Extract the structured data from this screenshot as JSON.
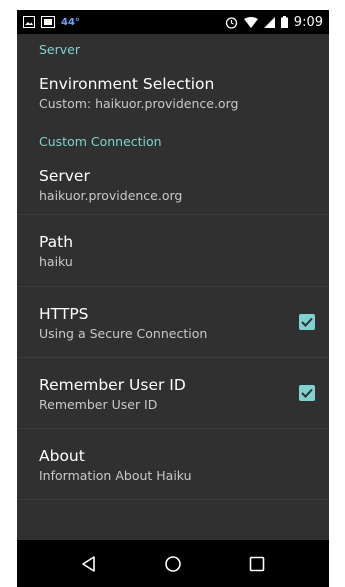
{
  "status_bar": {
    "temperature": "44°",
    "time": "9:09",
    "icons": [
      "image-icon",
      "gallery-icon",
      "alarm-icon",
      "wifi-icon",
      "signal-icon",
      "battery-icon"
    ]
  },
  "sections": [
    {
      "header": "Server",
      "items": [
        {
          "title": "Environment Selection",
          "subtitle": "Custom: haikuor.providence.org"
        }
      ]
    },
    {
      "header": "Custom Connection",
      "items": [
        {
          "title": "Server",
          "subtitle": "haikuor.providence.org"
        },
        {
          "title": "Path",
          "subtitle": "haiku"
        },
        {
          "title": "HTTPS",
          "subtitle": "Using a Secure Connection",
          "checked": true
        },
        {
          "title": "Remember User ID",
          "subtitle": "Remember User ID",
          "checked": true
        },
        {
          "title": "About",
          "subtitle": "Information About Haiku"
        }
      ]
    }
  ],
  "nav_bar": {
    "icons": [
      "back-icon",
      "home-icon",
      "recents-icon"
    ]
  },
  "colors": {
    "accent": "#7fd3cf",
    "background": "#303030",
    "status_bar": "#000000"
  }
}
